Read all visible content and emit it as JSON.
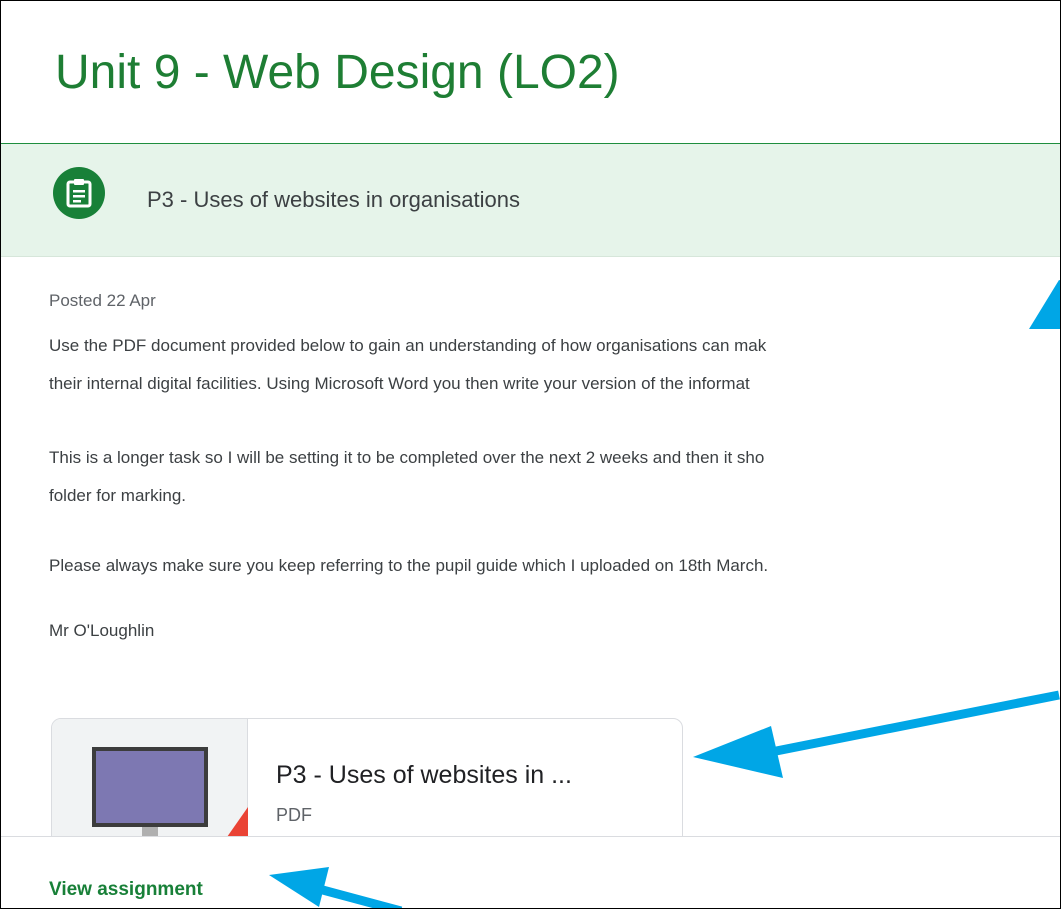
{
  "header": {
    "title": "Unit 9 - Web Design (LO2)"
  },
  "assignment": {
    "title": "P3 - Uses of websites in organisations",
    "posted": "Posted 22 Apr",
    "paragraph1_line1": "Use the PDF document provided below to gain an understanding of how organisations can mak",
    "paragraph1_line2": "their internal digital facilities.  Using Microsoft Word you then write your version of the informat",
    "paragraph2_line1": "This is a longer task so I will be setting it to be completed over the next 2 weeks and then it sho",
    "paragraph2_line2": "folder for marking.",
    "paragraph3": "Please always make sure you keep referring to the pupil guide which I uploaded on 18th March.",
    "signature": "Mr O'Loughlin"
  },
  "attachment": {
    "title": "P3 - Uses of websites in ...",
    "type": "PDF",
    "icon": "document-thumbnail"
  },
  "footer": {
    "view_label": "View assignment"
  },
  "colors": {
    "accent": "#188038",
    "banner": "#e6f4ea",
    "arrow": "#00a6e6"
  }
}
